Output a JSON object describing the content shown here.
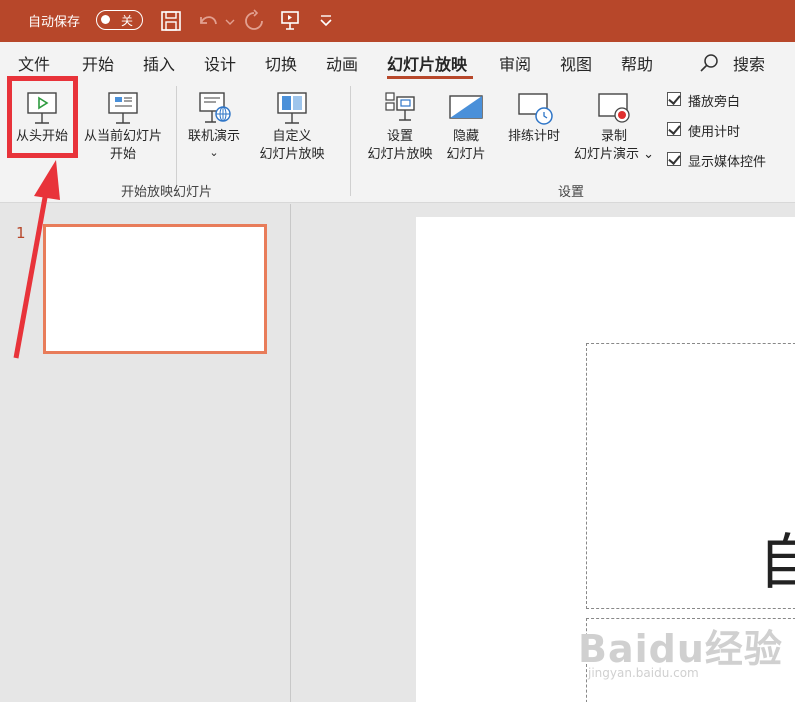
{
  "titlebar": {
    "autosave_label": "自动保存",
    "toggle_state": "关"
  },
  "tabs": [
    {
      "label": "文件"
    },
    {
      "label": "开始"
    },
    {
      "label": "插入"
    },
    {
      "label": "设计"
    },
    {
      "label": "切换"
    },
    {
      "label": "动画"
    },
    {
      "label": "幻灯片放映"
    },
    {
      "label": "审阅"
    },
    {
      "label": "视图"
    },
    {
      "label": "帮助"
    }
  ],
  "search_label": "搜索",
  "ribbon": {
    "from_beginning": "从头开始",
    "from_current_1": "从当前幻灯片",
    "from_current_2": "开始",
    "online_present": "联机演示",
    "custom_1": "自定义",
    "custom_2": "幻灯片放映",
    "group1_label": "开始放映幻灯片",
    "setup_1": "设置",
    "setup_2": "幻灯片放映",
    "hide_1": "隐藏",
    "hide_2": "幻灯片",
    "rehearse": "排练计时",
    "record_1": "录制",
    "record_2": "幻灯片演示",
    "group2_label": "设置",
    "chk_narration": "播放旁白",
    "chk_timings": "使用计时",
    "chk_media": "显示媒体控件"
  },
  "slides": {
    "number": "1"
  },
  "slide": {
    "partial_title_char": "自"
  },
  "watermark": {
    "brand": "Baidu经验",
    "url": "jingyan.baidu.com"
  },
  "colors": {
    "accent": "#b7472a",
    "highlight": "#e8333a",
    "thumb_border": "#e87c5a"
  },
  "icons": [
    "save-icon",
    "undo-icon",
    "redo-icon",
    "present-icon",
    "customize-icon",
    "search-icon"
  ]
}
